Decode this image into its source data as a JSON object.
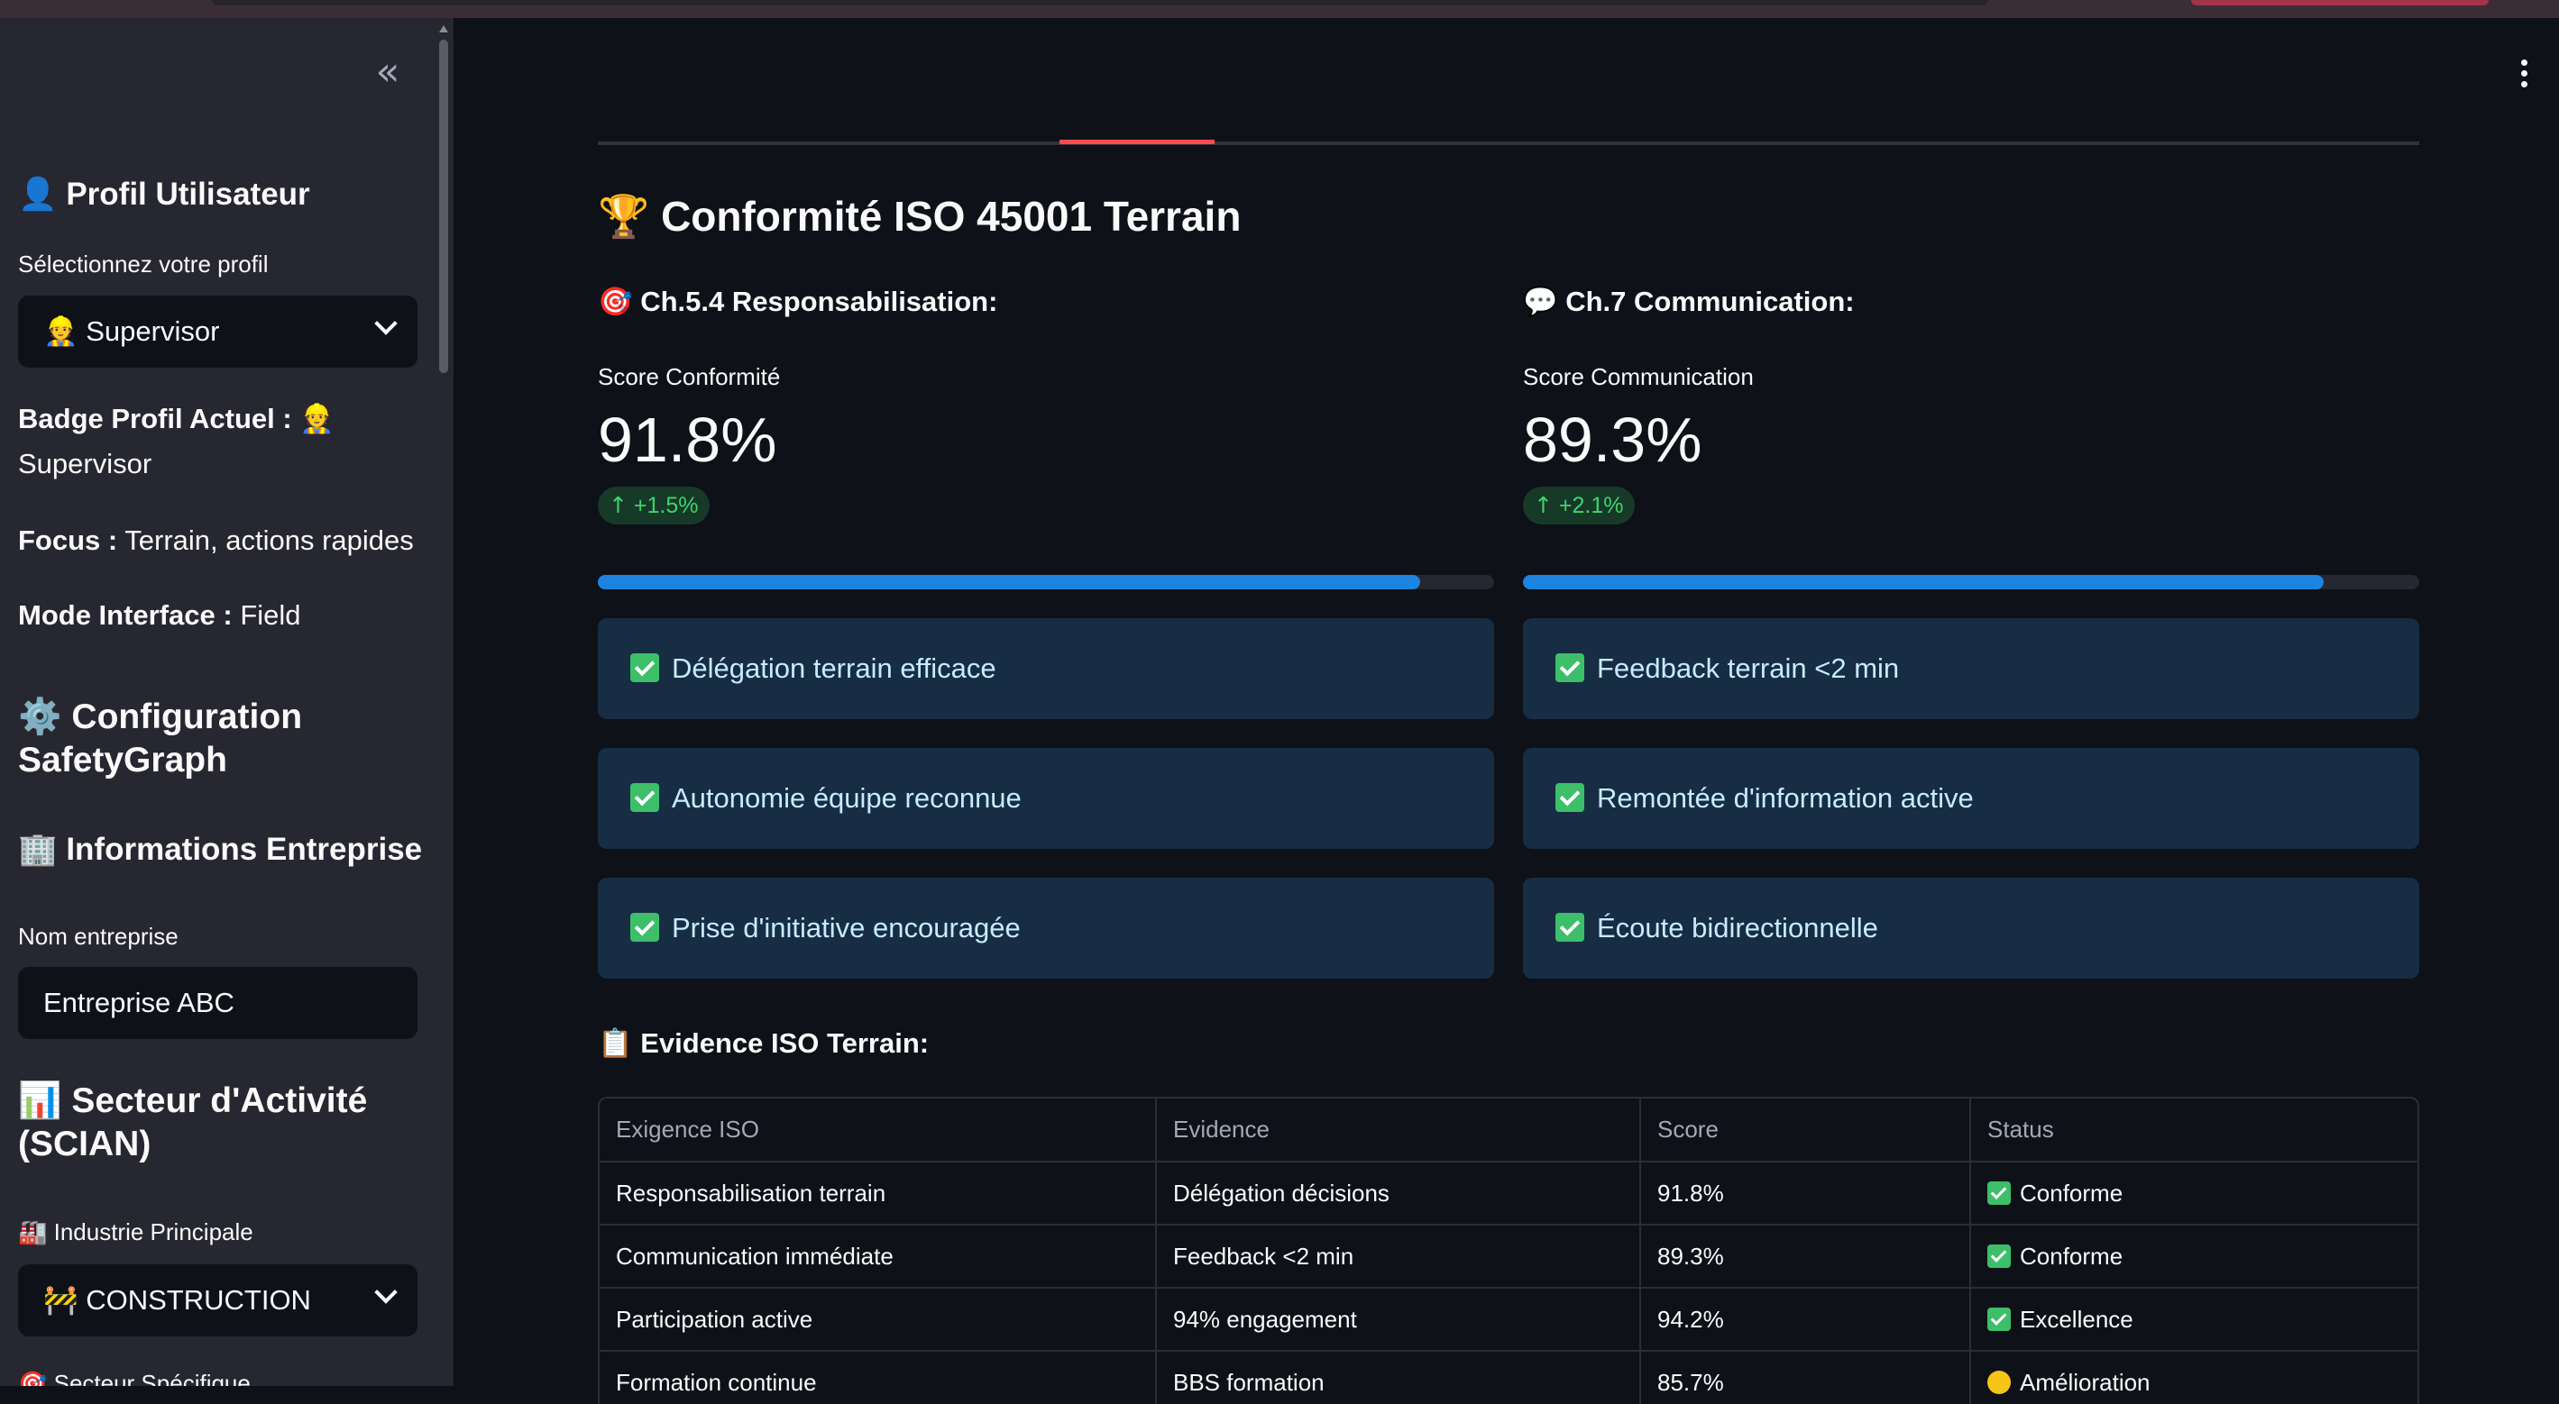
{
  "sidebar": {
    "collapse_icon": "«",
    "profile_heading": "Profil Utilisateur",
    "profile_label": "Sélectionnez votre profil",
    "profile_value": "Supervisor",
    "badge_label": "Badge Profil Actuel :",
    "badge_value": "Supervisor",
    "focus_label": "Focus :",
    "focus_value": "Terrain, actions rapides",
    "mode_label": "Mode Interface :",
    "mode_value": "Field",
    "config_heading_line1": "Configuration",
    "config_heading_line2": "SafetyGraph",
    "company_heading": "Informations Entreprise",
    "company_label": "Nom entreprise",
    "company_value": "Entreprise ABC",
    "sector_heading_line1": "Secteur d'Activité",
    "sector_heading_line2": "(SCIAN)",
    "industry_label": "Industrie Principale",
    "industry_value": "CONSTRUCTION",
    "specific_sector_label": "Secteur Spécifique"
  },
  "main": {
    "title": "Conformité ISO 45001 Terrain",
    "left": {
      "heading": "Ch.5.4 Responsabilisation:",
      "metric_label": "Score Conformité",
      "metric_value": "91.8%",
      "delta": "+1.5%",
      "progress": 0.918,
      "items": [
        "Délégation terrain efficace",
        "Autonomie équipe reconnue",
        "Prise d'initiative encouragée"
      ]
    },
    "right": {
      "heading": "Ch.7 Communication:",
      "metric_label": "Score Communication",
      "metric_value": "89.3%",
      "delta": "+2.1%",
      "progress": 0.893,
      "items": [
        "Feedback terrain <2 min",
        "Remontée d'information active",
        "Écoute bidirectionnelle"
      ]
    },
    "evidence_heading": "Evidence ISO Terrain:",
    "table": {
      "columns": [
        "Exigence ISO",
        "Evidence",
        "Score",
        "Status"
      ],
      "rows": [
        [
          "Responsabilisation terrain",
          "Délégation décisions",
          "91.8%",
          "Conforme"
        ],
        [
          "Communication immédiate",
          "Feedback <2 min",
          "89.3%",
          "Conforme"
        ],
        [
          "Participation active",
          "94% engagement",
          "94.2%",
          "Excellence"
        ],
        [
          "Formation continue",
          "BBS formation",
          "85.7%",
          "Amélioration"
        ]
      ]
    }
  },
  "colors": {
    "background": "#0e1117",
    "sidebar": "#262730",
    "accent_tab": "#ff4b4b",
    "progress": "#1c83e1",
    "info_box": "#172d43",
    "delta_green": "#3dd56d"
  }
}
